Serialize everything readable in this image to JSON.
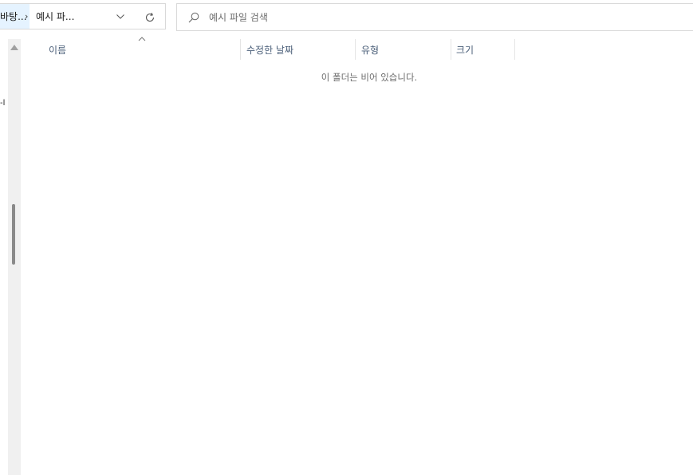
{
  "address_bar": {
    "parent_crumb": "바탕...",
    "separator": "›",
    "current_crumb": "예시 파..."
  },
  "search": {
    "placeholder": "예시 파일 검색"
  },
  "nav_pane": {
    "partial_label": "-l"
  },
  "columns": {
    "name": "이름",
    "modified": "수정한 날짜",
    "type": "유형",
    "size": "크기"
  },
  "empty_message": "이 폴더는 비어 있습니다.",
  "icons": {
    "dropdown": "chevron-down-icon",
    "refresh": "refresh-icon",
    "search": "search-icon",
    "scroll_up": "triangle-up-icon",
    "sort": "sort-ascending-icon"
  },
  "colors": {
    "breadcrumb_highlight": "#e5f3ff",
    "header_text": "#4c607a",
    "empty_text": "#6d6d6d",
    "scroll_thumb": "#8a8a8a"
  }
}
